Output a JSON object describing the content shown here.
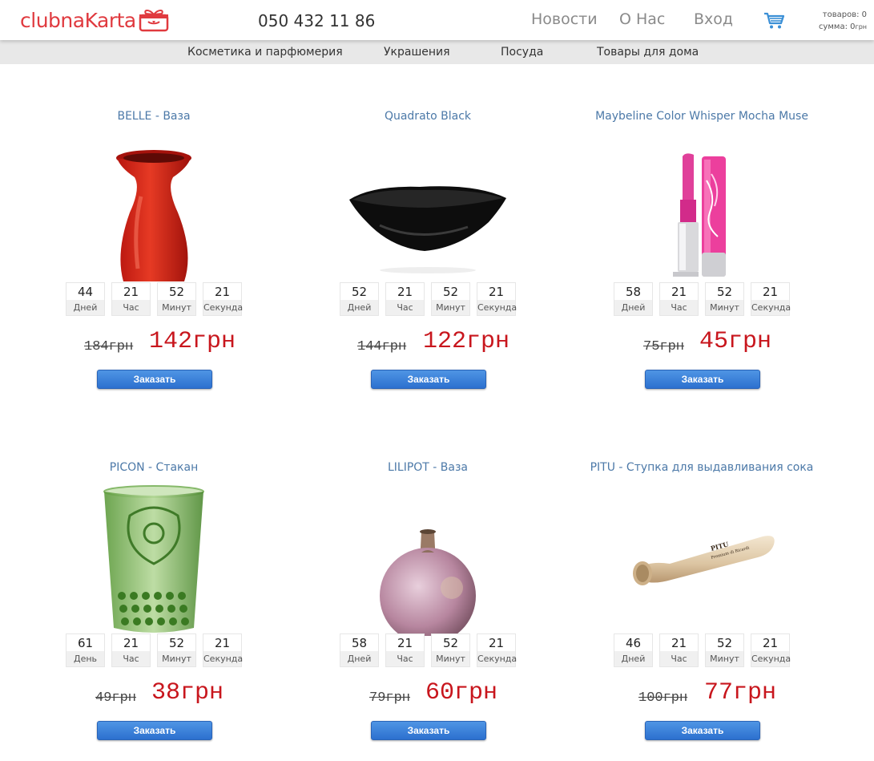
{
  "header": {
    "logo": {
      "part1": "clubna",
      "part2": "Karta"
    },
    "phone": "050 432 11 86",
    "nav": [
      "Новости",
      "О Нас",
      "Вход"
    ],
    "cart": {
      "items_label": "товаров: 0",
      "sum_label": "сумма: 0",
      "sum_currency": "грн"
    }
  },
  "categories": [
    "Косметика и парфюмерия",
    "Украшения",
    "Посуда",
    "Товары для дома"
  ],
  "products": [
    {
      "title": "BELLE - Ваза",
      "image": "red-vase",
      "timer": {
        "days": "44",
        "days_label": "Дней",
        "hours": "21",
        "hours_label": "Час",
        "minutes": "52",
        "minutes_label": "Минут",
        "seconds": "21",
        "seconds_label": "Секунда"
      },
      "old_price": "184грн",
      "new_price": "142грн",
      "button": "Заказать"
    },
    {
      "title": "Quadrato Black",
      "image": "black-bowl",
      "timer": {
        "days": "52",
        "days_label": "Дней",
        "hours": "21",
        "hours_label": "Час",
        "minutes": "52",
        "minutes_label": "Минут",
        "seconds": "21",
        "seconds_label": "Секунда"
      },
      "old_price": "144грн",
      "new_price": "122грн",
      "button": "Заказать"
    },
    {
      "title": "Maybeline Color Whisper Mocha Muse",
      "image": "lipstick",
      "timer": {
        "days": "58",
        "days_label": "Дней",
        "hours": "21",
        "hours_label": "Час",
        "minutes": "52",
        "minutes_label": "Минут",
        "seconds": "21",
        "seconds_label": "Секунда"
      },
      "old_price": "75грн",
      "new_price": "45грн",
      "button": "Заказать"
    },
    {
      "title": "PICON - Стакан",
      "image": "green-glass",
      "timer": {
        "days": "61",
        "days_label": "День",
        "hours": "21",
        "hours_label": "Час",
        "minutes": "52",
        "minutes_label": "Минут",
        "seconds": "21",
        "seconds_label": "Секунда"
      },
      "old_price": "49грн",
      "new_price": "38грн",
      "button": "Заказать"
    },
    {
      "title": "LILIPOT - Ваза",
      "image": "round-vase",
      "timer": {
        "days": "58",
        "days_label": "Дней",
        "hours": "21",
        "hours_label": "Час",
        "minutes": "52",
        "minutes_label": "Минут",
        "seconds": "21",
        "seconds_label": "Секунда"
      },
      "old_price": "79грн",
      "new_price": "60грн",
      "button": "Заказать"
    },
    {
      "title": "PITU - Ступка для выдавливания сока",
      "image": "wooden-muddler",
      "timer": {
        "days": "46",
        "days_label": "Дней",
        "hours": "21",
        "hours_label": "Час",
        "minutes": "52",
        "minutes_label": "Минут",
        "seconds": "21",
        "seconds_label": "Секунда"
      },
      "old_price": "100грн",
      "new_price": "77грн",
      "button": "Заказать",
      "image_text": {
        "brand": "PITU",
        "tagline": "Premium di Ricardi"
      }
    }
  ]
}
